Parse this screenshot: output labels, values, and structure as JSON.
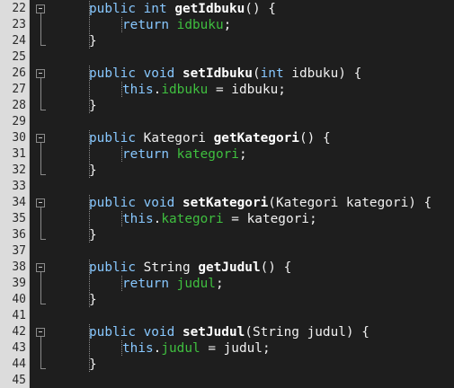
{
  "colors": {
    "background": "#1e1e1e",
    "gutter": "#dcdcdc",
    "keyword": "#88c8ff",
    "field": "#3fbf3f",
    "text": "#f0f0f0"
  },
  "fold_icon": "minus-box-icon",
  "lines": [
    {
      "num": "22",
      "fold": "start",
      "indent": 1,
      "tokens": [
        [
          "public int ",
          "kw"
        ],
        [
          "getIdbuku",
          "fn"
        ],
        [
          "() {",
          "p"
        ]
      ]
    },
    {
      "num": "23",
      "fold": "mid",
      "indent": 2,
      "tokens": [
        [
          "return ",
          "kw"
        ],
        [
          "idbuku",
          "fld"
        ],
        [
          ";",
          "p"
        ]
      ]
    },
    {
      "num": "24",
      "fold": "end",
      "indent": 1,
      "tokens": [
        [
          "}",
          "p"
        ]
      ]
    },
    {
      "num": "25",
      "fold": "none",
      "indent": 0,
      "tokens": []
    },
    {
      "num": "26",
      "fold": "start",
      "indent": 1,
      "tokens": [
        [
          "public void ",
          "kw"
        ],
        [
          "setIdbuku",
          "fn"
        ],
        [
          "(",
          "p"
        ],
        [
          "int ",
          "kw"
        ],
        [
          "idbuku) {",
          "p"
        ]
      ]
    },
    {
      "num": "27",
      "fold": "mid",
      "indent": 2,
      "tokens": [
        [
          "this",
          "kw"
        ],
        [
          ".",
          "p"
        ],
        [
          "idbuku",
          "fld"
        ],
        [
          " = idbuku;",
          "p"
        ]
      ]
    },
    {
      "num": "28",
      "fold": "end",
      "indent": 1,
      "tokens": [
        [
          "}",
          "p"
        ]
      ]
    },
    {
      "num": "29",
      "fold": "none",
      "indent": 0,
      "tokens": []
    },
    {
      "num": "30",
      "fold": "start",
      "indent": 1,
      "tokens": [
        [
          "public ",
          "kw"
        ],
        [
          "Kategori ",
          "p"
        ],
        [
          "getKategori",
          "fn"
        ],
        [
          "() {",
          "p"
        ]
      ]
    },
    {
      "num": "31",
      "fold": "mid",
      "indent": 2,
      "tokens": [
        [
          "return ",
          "kw"
        ],
        [
          "kategori",
          "fld"
        ],
        [
          ";",
          "p"
        ]
      ]
    },
    {
      "num": "32",
      "fold": "end",
      "indent": 1,
      "tokens": [
        [
          "}",
          "p"
        ]
      ]
    },
    {
      "num": "33",
      "fold": "none",
      "indent": 0,
      "tokens": []
    },
    {
      "num": "34",
      "fold": "start",
      "indent": 1,
      "tokens": [
        [
          "public void ",
          "kw"
        ],
        [
          "setKategori",
          "fn"
        ],
        [
          "(Kategori kategori) {",
          "p"
        ]
      ]
    },
    {
      "num": "35",
      "fold": "mid",
      "indent": 2,
      "tokens": [
        [
          "this",
          "kw"
        ],
        [
          ".",
          "p"
        ],
        [
          "kategori",
          "fld"
        ],
        [
          " = kategori;",
          "p"
        ]
      ]
    },
    {
      "num": "36",
      "fold": "end",
      "indent": 1,
      "tokens": [
        [
          "}",
          "p"
        ]
      ]
    },
    {
      "num": "37",
      "fold": "none",
      "indent": 0,
      "tokens": []
    },
    {
      "num": "38",
      "fold": "start",
      "indent": 1,
      "tokens": [
        [
          "public ",
          "kw"
        ],
        [
          "String ",
          "p"
        ],
        [
          "getJudul",
          "fn"
        ],
        [
          "() {",
          "p"
        ]
      ]
    },
    {
      "num": "39",
      "fold": "mid",
      "indent": 2,
      "tokens": [
        [
          "return ",
          "kw"
        ],
        [
          "judul",
          "fld"
        ],
        [
          ";",
          "p"
        ]
      ]
    },
    {
      "num": "40",
      "fold": "end",
      "indent": 1,
      "tokens": [
        [
          "}",
          "p"
        ]
      ]
    },
    {
      "num": "41",
      "fold": "none",
      "indent": 0,
      "tokens": []
    },
    {
      "num": "42",
      "fold": "start",
      "indent": 1,
      "tokens": [
        [
          "public void ",
          "kw"
        ],
        [
          "setJudul",
          "fn"
        ],
        [
          "(String judul) {",
          "p"
        ]
      ]
    },
    {
      "num": "43",
      "fold": "mid",
      "indent": 2,
      "tokens": [
        [
          "this",
          "kw"
        ],
        [
          ".",
          "p"
        ],
        [
          "judul",
          "fld"
        ],
        [
          " = judul;",
          "p"
        ]
      ]
    },
    {
      "num": "44",
      "fold": "end",
      "indent": 1,
      "tokens": [
        [
          "}",
          "p"
        ]
      ]
    },
    {
      "num": "45",
      "fold": "none",
      "indent": 0,
      "tokens": []
    }
  ]
}
